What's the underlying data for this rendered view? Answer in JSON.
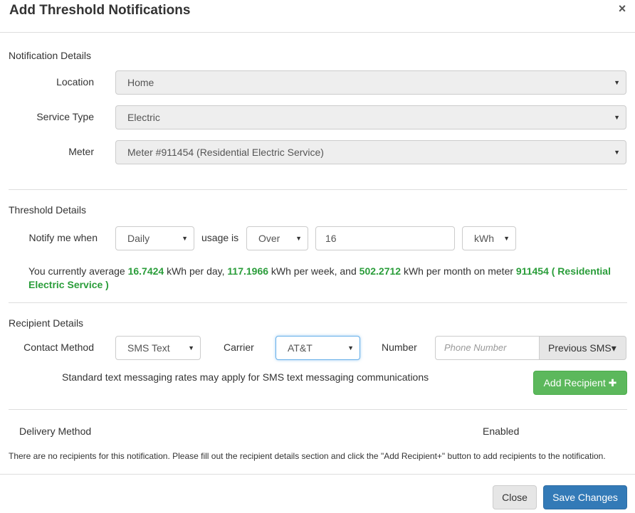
{
  "modal": {
    "title": "Add Threshold Notifications",
    "close_symbol": "×"
  },
  "notification_details": {
    "heading": "Notification Details",
    "location_label": "Location",
    "location_value": "Home",
    "service_type_label": "Service Type",
    "service_type_value": "Electric",
    "meter_label": "Meter",
    "meter_value": "Meter #911454 (Residential Electric Service)"
  },
  "threshold_details": {
    "heading": "Threshold Details",
    "notify_label": "Notify me when",
    "period_value": "Daily",
    "usage_label": "usage is",
    "comparison_value": "Over",
    "amount_value": "16",
    "unit_value": "kWh",
    "info": {
      "prefix": "You currently average",
      "day_value": "16.7424",
      "day_suffix": "kWh per day,",
      "week_value": "117.1966",
      "week_suffix": "kWh per week, and",
      "month_value": "502.2712",
      "month_suffix": "kWh per month on meter",
      "meter_name": "911454 ( Residential Electric Service )"
    }
  },
  "recipient_details": {
    "heading": "Recipient Details",
    "contact_method_label": "Contact Method",
    "contact_method_value": "SMS Text",
    "carrier_label": "Carrier",
    "carrier_value": "AT&T",
    "number_label": "Number",
    "phone_placeholder": "Phone Number",
    "previous_sms_label": "Previous SMS",
    "rates_note": "Standard text messaging rates may apply for SMS text messaging communications",
    "add_recipient_label": "Add Recipient",
    "add_symbol": "✚"
  },
  "recipients_table": {
    "col_delivery": "Delivery Method",
    "col_enabled": "Enabled",
    "empty_message": "There are no recipients for this notification. Please fill out the recipient details section and click the \"Add Recipient+\" button to add recipients to the notification."
  },
  "footer": {
    "close_label": "Close",
    "save_label": "Save Changes"
  },
  "icons": {
    "caret": "▼",
    "caret_small": "▾"
  },
  "colors": {
    "accent_green": "#2a9d3a",
    "button_green": "#5cb85c",
    "button_blue": "#337ab7"
  }
}
